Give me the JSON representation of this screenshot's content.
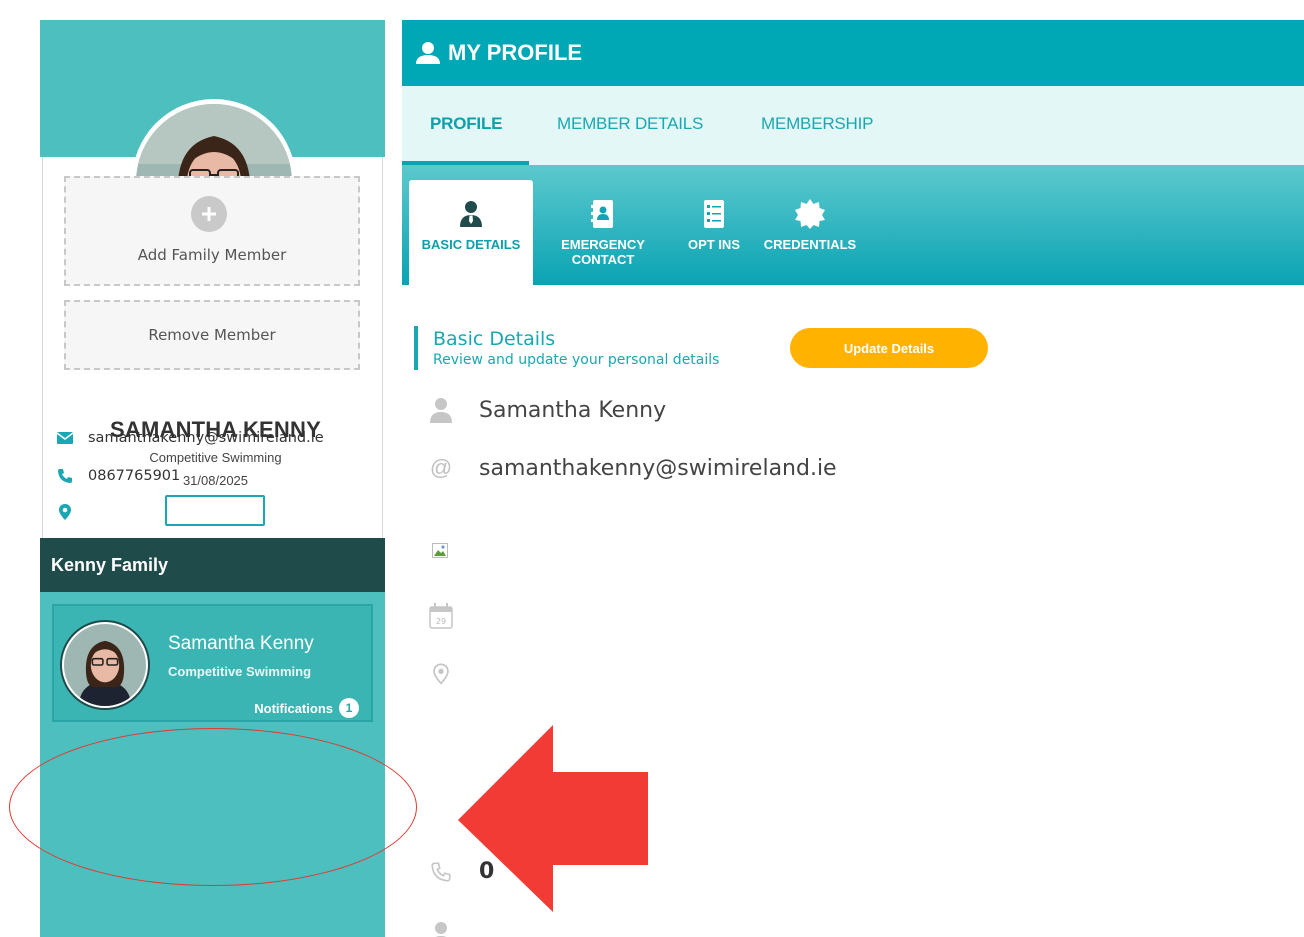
{
  "sidebar": {
    "profile": {
      "name": "SAMANTHA KENNY",
      "discipline": "Competitive Swimming",
      "date": "31/08/2025",
      "email": "samanthakenny@swimireland.ie",
      "phone": "0867765901",
      "location": ""
    },
    "family": {
      "title": "Kenny Family",
      "member": {
        "name": "Samantha Kenny",
        "discipline": "Competitive Swimming",
        "notifications_label": "Notifications",
        "notifications_count": "1"
      },
      "add_label": "Add Family Member",
      "remove_label": "Remove Member"
    }
  },
  "main": {
    "title": "MY PROFILE",
    "tabs": [
      {
        "label": "PROFILE",
        "active": true
      },
      {
        "label": "MEMBER DETAILS",
        "active": false
      },
      {
        "label": "MEMBERSHIP",
        "active": false
      }
    ],
    "subtabs": [
      {
        "line1": "BASIC DETAILS",
        "line2": "",
        "icon": "person-tie-icon",
        "active": true
      },
      {
        "line1": "EMERGENCY",
        "line2": "CONTACT",
        "icon": "contact-book-icon",
        "active": false
      },
      {
        "line1": "OPT INS",
        "line2": "",
        "icon": "checklist-icon",
        "active": false
      },
      {
        "line1": "CREDENTIALS",
        "line2": "",
        "icon": "badge-icon",
        "active": false
      }
    ],
    "section": {
      "title": "Basic Details",
      "subtitle": "Review and update your personal details",
      "update_button": "Update Details"
    },
    "details": {
      "name": "Samantha Kenny",
      "email": "samanthakenny@swimireland.ie",
      "phone_partial": "0"
    },
    "calendar_icon_day": "29"
  },
  "colors": {
    "teal": "#00a7b5",
    "teal_light": "#4dbfbe",
    "dark_teal": "#1f4b4b",
    "amber": "#ffb300",
    "annotation_red": "#e0392f"
  }
}
